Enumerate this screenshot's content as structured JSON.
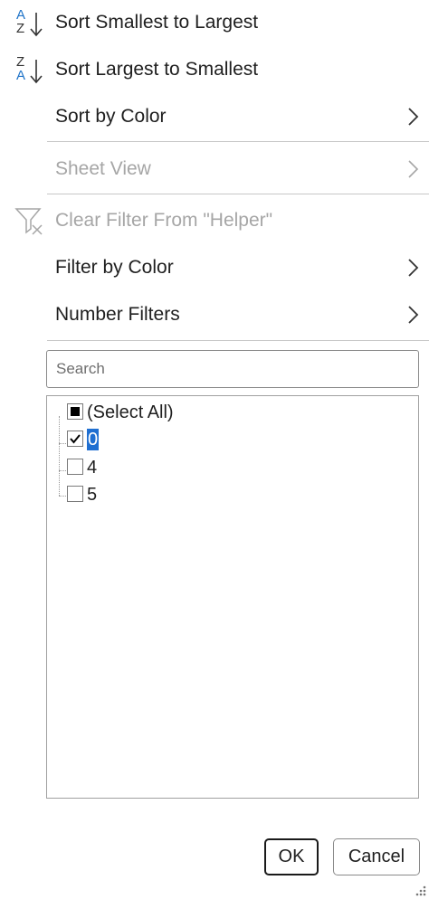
{
  "menu": {
    "sort_asc": {
      "label": "Sort Smallest to Largest",
      "icon": "sort-ascending-icon",
      "icon_top": "A",
      "icon_bottom": "Z"
    },
    "sort_desc": {
      "label": "Sort Largest to Smallest",
      "icon": "sort-descending-icon",
      "icon_top": "Z",
      "icon_bottom": "A"
    },
    "sort_by_color": {
      "label": "Sort by Color"
    },
    "sheet_view": {
      "label": "Sheet View",
      "disabled": true
    },
    "clear_filter": {
      "label": "Clear Filter From \"Helper\"",
      "icon": "clear-filter-icon",
      "disabled": true
    },
    "filter_by_color": {
      "label": "Filter by Color"
    },
    "number_filters": {
      "label": "Number Filters"
    }
  },
  "search": {
    "placeholder": "Search",
    "value": ""
  },
  "list": {
    "items": [
      {
        "label": "(Select All)",
        "state": "indeterminate"
      },
      {
        "label": "0",
        "state": "checked",
        "selected": true
      },
      {
        "label": "4",
        "state": "unchecked"
      },
      {
        "label": "5",
        "state": "unchecked"
      }
    ]
  },
  "buttons": {
    "ok": "OK",
    "cancel": "Cancel"
  },
  "colors": {
    "accent": "#1f6fd1",
    "sort_icon_blue": "#1e73c8",
    "disabled_text": "#a6a6a6"
  }
}
